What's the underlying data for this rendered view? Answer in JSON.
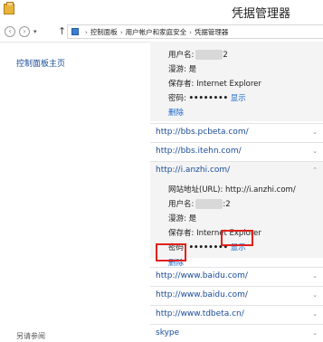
{
  "window": {
    "title": "凭据管理器"
  },
  "breadcrumbs": [
    "控制面板",
    "用户帐户和家庭安全",
    "凭据管理器"
  ],
  "sidebar": {
    "home_link": "控制面板主页",
    "see_also": "另请参阅"
  },
  "entry_top": {
    "username_label": "用户名:",
    "username_suffix": "2",
    "roaming": "漫游: 是",
    "saved_by": "保存者: Internet Explorer",
    "password_label": "密码:",
    "password_dots": "••••••••",
    "show": "显示",
    "delete": "删除"
  },
  "credentials": [
    "http://bbs.pcbeta.com/",
    "http://bbs.itehn.com/",
    "http://i.anzhi.com/"
  ],
  "expanded": {
    "url": "网站地址(URL): http://i.anzhi.com/",
    "username_label": "用户名:",
    "username_suffix": ":2",
    "roaming": "漫游: 是",
    "saved_by": "保存者: Internet Explorer",
    "password_label": "密码:",
    "password_dots": "••••••••",
    "show": "显示",
    "delete": "删除"
  },
  "credentials_after": [
    "http://www.baidu.com/",
    "http://www.baidu.com/",
    "http://www.tdbeta.cn/",
    "skype"
  ]
}
